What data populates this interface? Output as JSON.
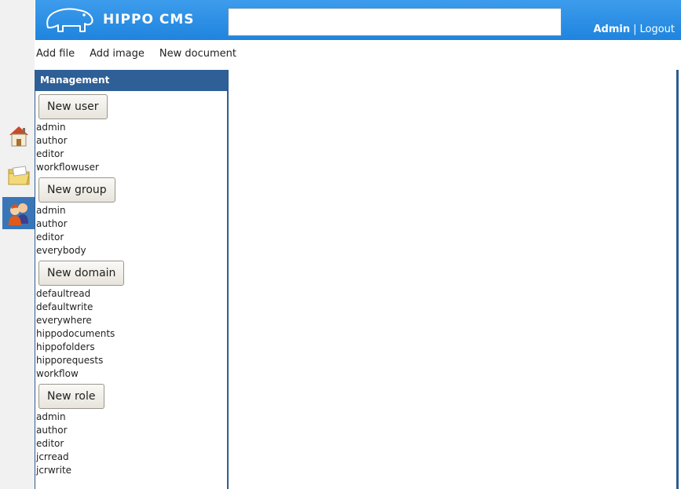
{
  "header": {
    "logo_text": "HIPPO CMS",
    "search_value": "",
    "user_name": "Admin",
    "separator": "|",
    "logout_label": "Logout"
  },
  "toolbar": {
    "add_file": "Add file",
    "add_image": "Add image",
    "new_document": "New document"
  },
  "nav": {
    "icons": [
      "home-icon",
      "folder-icon",
      "users-icon"
    ],
    "active": "users-icon"
  },
  "panel": {
    "title": "Management",
    "users": {
      "button": "New user",
      "items": [
        "admin",
        "author",
        "editor",
        "workflowuser"
      ]
    },
    "groups": {
      "button": "New group",
      "items": [
        "admin",
        "author",
        "editor",
        "everybody"
      ]
    },
    "domains": {
      "button": "New domain",
      "items": [
        "defaultread",
        "defaultwrite",
        "everywhere",
        "hippodocuments",
        "hippofolders",
        "hipporequests",
        "workflow"
      ]
    },
    "roles": {
      "button": "New role",
      "items": [
        "admin",
        "author",
        "editor",
        "jcrread",
        "jcrwrite"
      ]
    }
  },
  "colors": {
    "header": "#2a8fe6",
    "panel_head": "#2e5f96",
    "active_nav": "#3a76b7"
  }
}
